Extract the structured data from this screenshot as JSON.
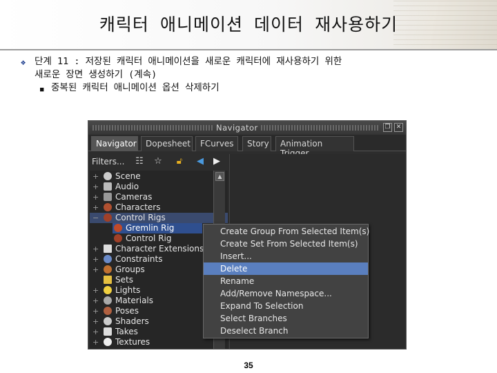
{
  "slide": {
    "title": "캐릭터 애니메이션 데이터 재사용하기",
    "bullet1_mark": "❖",
    "bullet1_line1": "단계 11 : 저장된 캐릭터 애니메이션을 새로운 캐릭터에 재사용하기 위한",
    "bullet1_line2": "새로운 장면 생성하기 (계속)",
    "bullet2_mark": "■",
    "bullet2_text": "중복된 캐릭터 애니메이션 옵션 삭제하기",
    "page_number": "35"
  },
  "window": {
    "title": "Navigator",
    "restore_icon": "restore-icon",
    "close_icon": "close-icon"
  },
  "tabs": [
    {
      "label": "Navigator"
    },
    {
      "label": "Dopesheet"
    },
    {
      "label": "FCurves"
    },
    {
      "label": "Story"
    },
    {
      "label": "Animation Trigger"
    }
  ],
  "toolbar": {
    "filters_label": "Filters...",
    "icons": [
      "list-view-icon",
      "star-pointer-icon",
      "lock-icon",
      "back-arrow-icon",
      "forward-arrow-icon"
    ]
  },
  "tree": [
    {
      "label": "Scene",
      "icon": "scene-icon",
      "expander": "+"
    },
    {
      "label": "Audio",
      "icon": "audio-icon",
      "expander": "+"
    },
    {
      "label": "Cameras",
      "icon": "camera-icon",
      "expander": "+"
    },
    {
      "label": "Characters",
      "icon": "character-icon",
      "expander": "+"
    },
    {
      "label": "Control Rigs",
      "icon": "control-rig-icon",
      "expander": "−"
    },
    {
      "label": "Gremlin Rig",
      "icon": "rig-icon",
      "expander": ""
    },
    {
      "label": "Control Rig",
      "icon": "rig-icon",
      "expander": ""
    },
    {
      "label": "Character Extensions",
      "icon": "extension-icon",
      "expander": "+"
    },
    {
      "label": "Constraints",
      "icon": "constraint-icon",
      "expander": "+"
    },
    {
      "label": "Groups",
      "icon": "groups-icon",
      "expander": "+"
    },
    {
      "label": "Sets",
      "icon": "folder-icon",
      "expander": ""
    },
    {
      "label": "Lights",
      "icon": "light-icon",
      "expander": "+"
    },
    {
      "label": "Materials",
      "icon": "material-icon",
      "expander": "+"
    },
    {
      "label": "Poses",
      "icon": "pose-icon",
      "expander": "+"
    },
    {
      "label": "Shaders",
      "icon": "shader-icon",
      "expander": "+"
    },
    {
      "label": "Takes",
      "icon": "take-icon",
      "expander": "+"
    },
    {
      "label": "Textures",
      "icon": "texture-icon",
      "expander": "+"
    }
  ],
  "context_menu": {
    "items": [
      {
        "label": "Create Group From Selected Item(s)"
      },
      {
        "label": "Create Set From Selected Item(s)"
      },
      {
        "label": "Insert..."
      },
      {
        "label": "Delete"
      },
      {
        "label": "Rename"
      },
      {
        "label": "Add/Remove Namespace..."
      },
      {
        "label": "Expand To Selection"
      },
      {
        "label": "Select Branches"
      },
      {
        "label": "Deselect Branch"
      }
    ],
    "active_item": "Delete"
  },
  "colors": {
    "bullet_accent": "#1f3f8f",
    "menu_highlight": "#5a7fbf",
    "tree_selection": "#2f4f8f"
  }
}
